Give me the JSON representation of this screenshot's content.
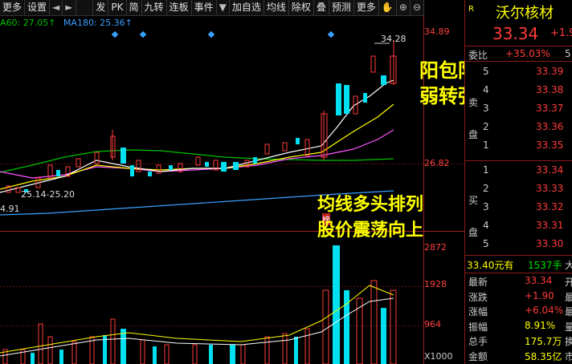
{
  "toolbar": {
    "more": "更多",
    "settings": "设置",
    "items": [
      "发",
      "PK",
      "简",
      "九转",
      "连板",
      "事件",
      "加自选",
      "均线",
      "除权",
      "叠",
      "预测",
      "更多"
    ],
    "dropdown_arrow": "▼",
    "back_arrow": "◄",
    "forward_arrow": "►"
  },
  "ma_legend": {
    "ma60": "A60: 27.05↑",
    "ma180": "MA180: 25.36↑"
  },
  "price_axis": {
    "top": "34.89",
    "mid": "26.82",
    "vol_top": "2872",
    "vol_mid": "1928",
    "vol_low": "964",
    "vol_unit": "X1000"
  },
  "chart_labels": {
    "high": "34.28",
    "range": "25.14-25.20",
    "low": "4.91",
    "marker": "榜"
  },
  "annotations": {
    "a1_line1": "阳包阴",
    "a1_line2": "弱转强",
    "a2_line1": "均线多头排列",
    "a2_line2": "股价震荡向上"
  },
  "quote": {
    "r_mark": "R",
    "name": "沃尔核材",
    "price": "33.34",
    "change_short": "+1.9",
    "weibi_label": "委比",
    "weibi_value": "+35.03%",
    "weibi_extra": "5",
    "sell_label": "卖盘",
    "buy_label": "买盘",
    "sell": [
      {
        "lvl": "5",
        "price": "33.39"
      },
      {
        "lvl": "4",
        "price": "33.38"
      },
      {
        "lvl": "3",
        "price": "33.37"
      },
      {
        "lvl": "2",
        "price": "33.36"
      },
      {
        "lvl": "1",
        "price": "33.35"
      }
    ],
    "buy": [
      {
        "lvl": "1",
        "price": "33.34"
      },
      {
        "lvl": "2",
        "price": "33.33"
      },
      {
        "lvl": "3",
        "price": "33.32"
      },
      {
        "lvl": "4",
        "price": "33.31"
      },
      {
        "lvl": "5",
        "price": "33.30"
      }
    ],
    "trade_price": "33.40元有",
    "trade_vol": "1537手",
    "trade_dir": "大",
    "stats": [
      {
        "label": "最新",
        "value": "33.34",
        "extra": "开"
      },
      {
        "label": "涨跌",
        "value": "+1.90",
        "extra": "最"
      },
      {
        "label": "涨幅",
        "value": "+6.04%",
        "extra": "最"
      },
      {
        "label": "振幅",
        "value": "8.91%",
        "extra": "量"
      },
      {
        "label": "总手",
        "value": "175.7万",
        "extra": "换"
      },
      {
        "label": "金额",
        "value": "58.35亿",
        "extra": "市"
      }
    ]
  },
  "colors": {
    "up": "#ff3b3b",
    "down": "#00e0f0",
    "ma5": "#ffffff",
    "ma10": "#ffff00",
    "ma20": "#ff55ff",
    "ma60": "#00c000",
    "ma180": "#3aa0ff"
  }
}
